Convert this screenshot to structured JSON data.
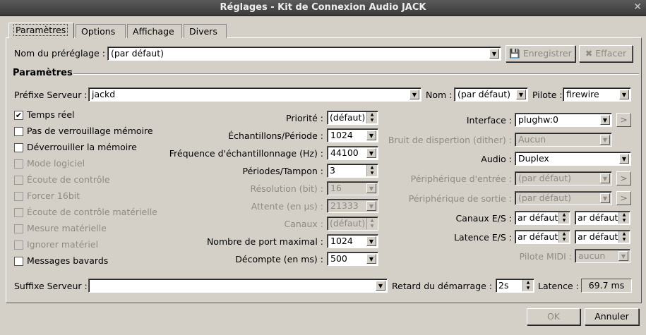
{
  "window": {
    "title": "Réglages - Kit de Connexion Audio JACK",
    "close": "✕"
  },
  "tabs": [
    "Paramètres",
    "Options",
    "Affichage",
    "Divers"
  ],
  "preset": {
    "label": "Nom du préréglage :",
    "value": "(par défaut)",
    "save": "Enregistrer",
    "delete": "Effacer"
  },
  "group": "Paramètres",
  "server": {
    "prefix_label": "Préfixe Serveur :",
    "prefix": "jackd",
    "name_label": "Nom :",
    "name": "(par défaut)",
    "driver_label": "Pilote :",
    "driver": "firewire"
  },
  "checks": [
    {
      "label": "Temps réel",
      "checked": true,
      "enabled": true
    },
    {
      "label": "Pas de verrouillage mémoire",
      "checked": false,
      "enabled": true
    },
    {
      "label": "Déverrouiller la mémoire",
      "checked": false,
      "enabled": true
    },
    {
      "label": "Mode logiciel",
      "checked": false,
      "enabled": false
    },
    {
      "label": "Écoute de contrôle",
      "checked": false,
      "enabled": false
    },
    {
      "label": "Forcer 16bit",
      "checked": false,
      "enabled": false
    },
    {
      "label": "Écoute de contrôle matérielle",
      "checked": false,
      "enabled": false
    },
    {
      "label": "Mesure matérielle",
      "checked": false,
      "enabled": false
    },
    {
      "label": "Ignorer matériel",
      "checked": false,
      "enabled": false
    },
    {
      "label": "Messages bavards",
      "checked": false,
      "enabled": true
    }
  ],
  "mid": [
    {
      "label": "Priorité :",
      "value": "(défaut)",
      "enabled": true,
      "type": "spin"
    },
    {
      "label": "Échantillons/Période :",
      "value": "1024",
      "enabled": true,
      "type": "combo"
    },
    {
      "label": "Fréquence d'échantillonnage (Hz) :",
      "value": "44100",
      "enabled": true,
      "type": "combo"
    },
    {
      "label": "Périodes/Tampon :",
      "value": "3",
      "enabled": true,
      "type": "spin"
    },
    {
      "label": "Résolution (bit) :",
      "value": "16",
      "enabled": false,
      "type": "combo"
    },
    {
      "label": "Attente (en µs) :",
      "value": "21333",
      "enabled": false,
      "type": "combo"
    },
    {
      "label": "Canaux :",
      "value": "(défaut)",
      "enabled": false,
      "type": "spin"
    },
    {
      "label": "Nombre de port maximal :",
      "value": "1024",
      "enabled": true,
      "type": "combo"
    },
    {
      "label": "Décompte (en ms) :",
      "value": "500",
      "enabled": true,
      "type": "combo"
    }
  ],
  "right": [
    {
      "label": "Interface :",
      "value": "plughw:0",
      "enabled": true,
      "more": ">"
    },
    {
      "label": "Bruit de dispertion (dither) :",
      "value": "Aucun",
      "enabled": false
    },
    {
      "label": "Audio :",
      "value": "Duplex",
      "enabled": true
    },
    {
      "label": "Périphérique d'entrée :",
      "value": "(par défaut)",
      "enabled": false,
      "more": ">"
    },
    {
      "label": "Périphérique de sortie :",
      "value": "(par défaut)",
      "enabled": false,
      "more": ">"
    }
  ],
  "io": {
    "channels_label": "Canaux E/S :",
    "latency_label": "Latence E/S :",
    "in": "ar défaut)",
    "out": "ar défaut)",
    "midi_label": "Pilote MIDI :",
    "midi": "aucun"
  },
  "suffix": {
    "label": "Suffixe Serveur :",
    "value": "",
    "delay_label": "Retard du démarrage :",
    "delay": "2s",
    "latency_label": "Latence :",
    "latency": "69.7 ms"
  },
  "buttons": {
    "ok": "OK",
    "cancel": "Annuler"
  }
}
